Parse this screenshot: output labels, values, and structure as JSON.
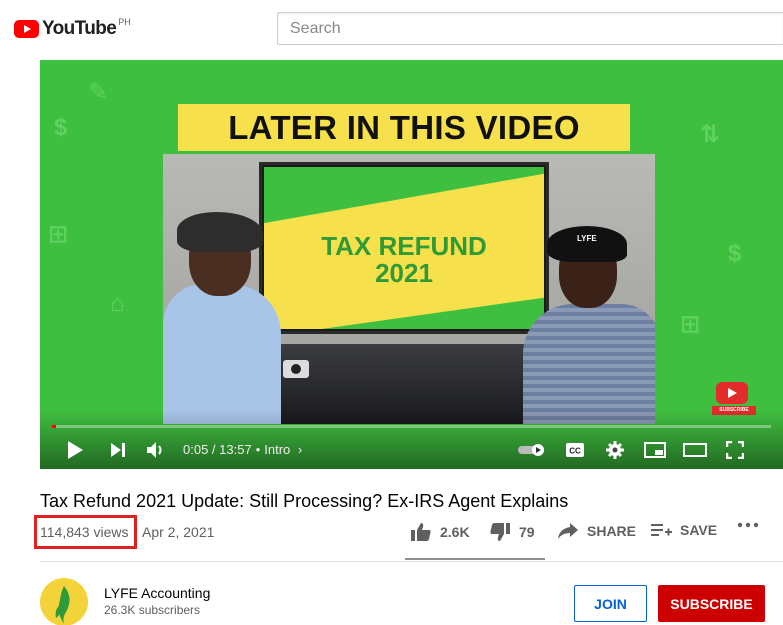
{
  "header": {
    "logo_text": "YouTube",
    "logo_region": "PH",
    "search_placeholder": "Search"
  },
  "player": {
    "banner_text": "LATER IN THIS VIDEO",
    "tv_text_line1": "TAX REFUND",
    "tv_text_line2": "2021",
    "cap_text": "LYFE",
    "side_subscribe_text": "SUBSCRIBE",
    "current_time": "0:05",
    "duration": "13:57",
    "chapter": "Intro",
    "progress_fraction": 0.006,
    "colors": {
      "background": "#3fbf3f",
      "banner": "#f6e04b",
      "progress": "#ff0000"
    }
  },
  "video": {
    "title": "Tax Refund 2021 Update: Still Processing? Ex-IRS Agent Explains",
    "views": "114,843 views",
    "date": "Apr 2, 2021",
    "likes": "2.6K",
    "dislikes": "79",
    "share_label": "SHARE",
    "save_label": "SAVE"
  },
  "channel": {
    "name": "LYFE Accounting",
    "subscribers": "26.3K subscribers",
    "join_label": "JOIN",
    "subscribe_label": "SUBSCRIBE"
  },
  "icons": [
    "youtube-logo-icon",
    "play-icon",
    "next-icon",
    "volume-icon",
    "chevron-right-icon",
    "autoplay-toggle-icon",
    "captions-icon",
    "settings-icon",
    "miniplayer-icon",
    "theater-icon",
    "fullscreen-icon",
    "thumbs-up-icon",
    "thumbs-down-icon",
    "share-icon",
    "save-playlist-icon",
    "more-icon"
  ]
}
